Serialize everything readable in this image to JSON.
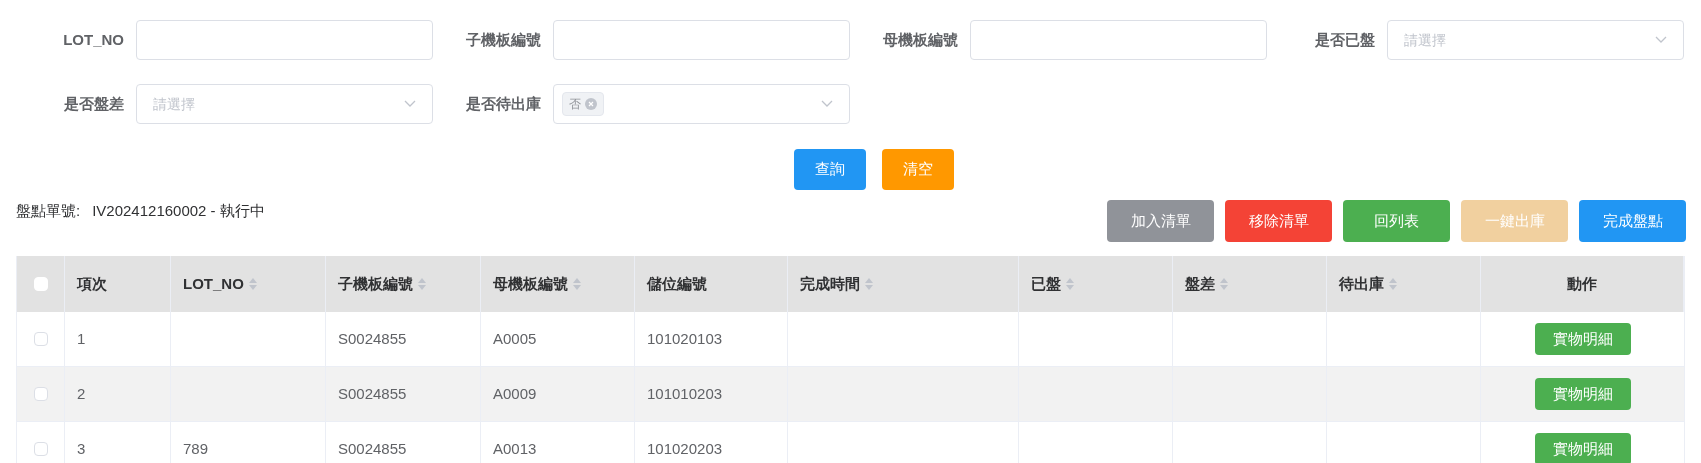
{
  "filters": [
    {
      "label": "LOT_NO",
      "kind": "text"
    },
    {
      "label": "子機板編號",
      "kind": "text"
    },
    {
      "label": "母機板編號",
      "kind": "text"
    },
    {
      "label": "是否已盤",
      "kind": "select",
      "placeholder": "請選擇"
    },
    {
      "label": "是否盤差",
      "kind": "select",
      "placeholder": "請選擇"
    },
    {
      "label": "是否待出庫",
      "kind": "select",
      "tags": [
        "否"
      ]
    }
  ],
  "search_buttons": [
    {
      "label": "查詢",
      "color": "#2196f3"
    },
    {
      "label": "清空",
      "color": "#ff9800"
    }
  ],
  "order": {
    "label": "盤點單號:",
    "value": "IV202412160002 - 執行中"
  },
  "action_buttons": [
    {
      "label": "加入清單",
      "color": "#909399"
    },
    {
      "label": "移除清單",
      "color": "#f44336"
    },
    {
      "label": "回列表",
      "color": "#4caf50"
    },
    {
      "label": "一鍵出庫",
      "color": "#f1d09f"
    },
    {
      "label": "完成盤點",
      "color": "#2196f3"
    }
  ],
  "table": {
    "all_checked": false,
    "columns": [
      {
        "label": "項次",
        "sortable": false
      },
      {
        "label": "LOT_NO",
        "sortable": true
      },
      {
        "label": "子機板編號",
        "sortable": true
      },
      {
        "label": "母機板編號",
        "sortable": true
      },
      {
        "label": "儲位編號",
        "sortable": false
      },
      {
        "label": "完成時間",
        "sortable": true
      },
      {
        "label": "已盤",
        "sortable": true
      },
      {
        "label": "盤差",
        "sortable": true
      },
      {
        "label": "待出庫",
        "sortable": true
      },
      {
        "label": "動作",
        "sortable": false
      }
    ],
    "rows": [
      {
        "selected": false,
        "cells": [
          "1",
          "",
          "S0024855",
          "A0005",
          "101020103",
          "",
          "",
          "",
          ""
        ],
        "action": "實物明細"
      },
      {
        "selected": false,
        "cells": [
          "2",
          "",
          "S0024855",
          "A0009",
          "101010203",
          "",
          "",
          "",
          ""
        ],
        "action": "實物明細"
      },
      {
        "selected": false,
        "cells": [
          "3",
          "789",
          "S0024855",
          "A0013",
          "101020203",
          "",
          "",
          "",
          ""
        ],
        "action": "實物明細"
      }
    ]
  }
}
